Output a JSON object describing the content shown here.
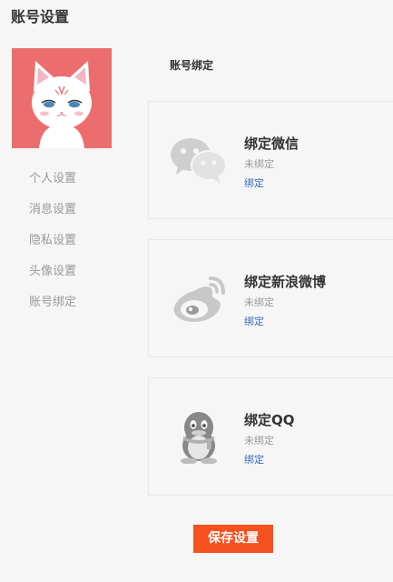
{
  "page": {
    "title": "账号设置"
  },
  "sidebar": {
    "items": [
      {
        "label": "个人设置"
      },
      {
        "label": "消息设置"
      },
      {
        "label": "隐私设置"
      },
      {
        "label": "头像设置"
      },
      {
        "label": "账号绑定"
      }
    ]
  },
  "main": {
    "section_title": "账号绑定",
    "bindings": [
      {
        "icon": "wechat-icon",
        "name": "绑定微信",
        "status": "未绑定",
        "action": "绑定"
      },
      {
        "icon": "weibo-icon",
        "name": "绑定新浪微博",
        "status": "未绑定",
        "action": "绑定"
      },
      {
        "icon": "qq-icon",
        "name": "绑定QQ",
        "status": "未绑定",
        "action": "绑定"
      }
    ]
  },
  "footer": {
    "save_label": "保存设置"
  },
  "colors": {
    "avatar_bg": "#ec6d6d",
    "save_button": "#f4511e",
    "link": "#3a6ab8"
  }
}
